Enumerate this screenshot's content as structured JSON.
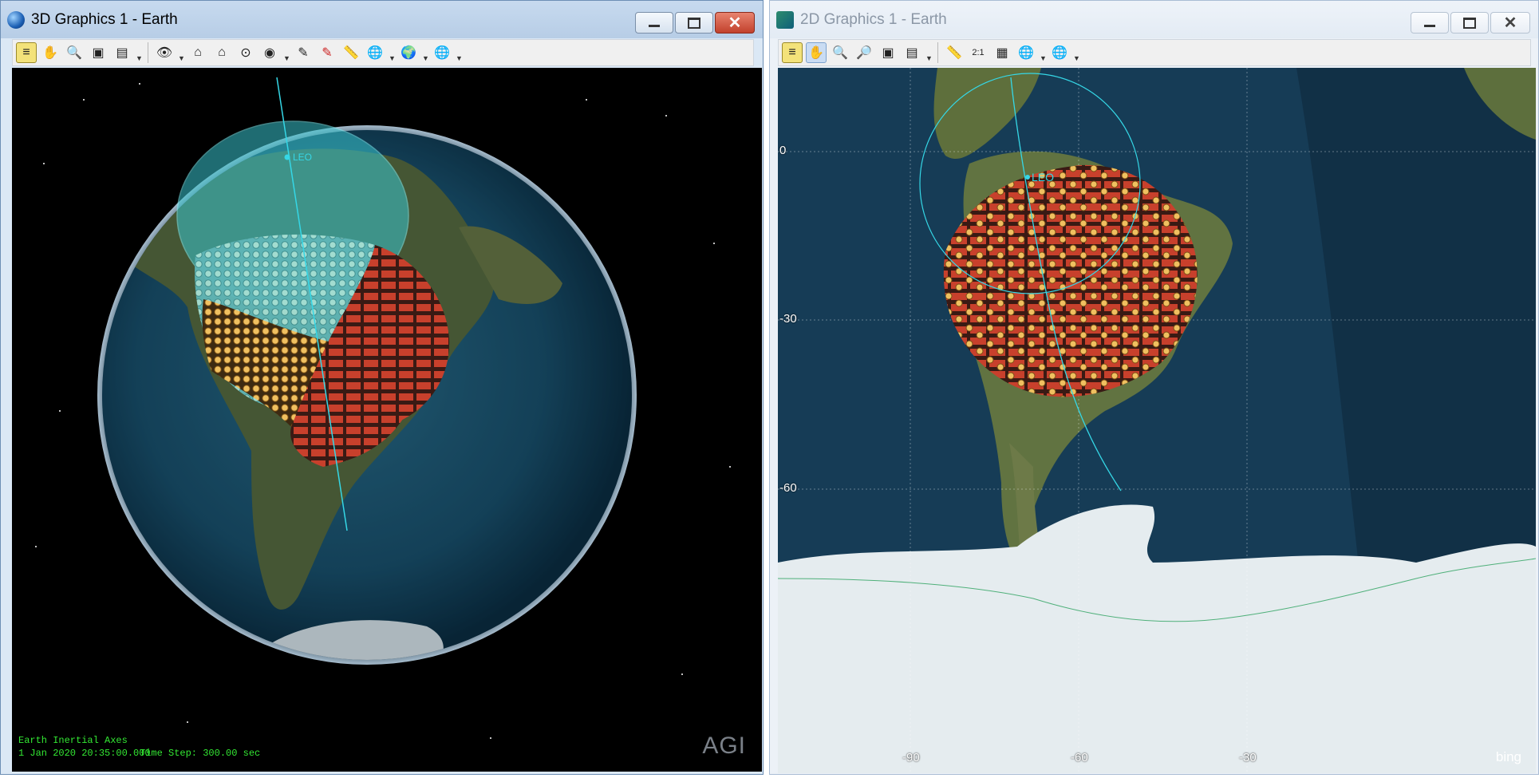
{
  "left_window": {
    "title": "3D Graphics 1 - Earth",
    "hud_axes": "Earth Inertial Axes",
    "hud_time": "1 Jan 2020 20:35:00.000",
    "hud_step": "Time Step: 300.00 sec",
    "logo": "AGI",
    "satellite_label": "LEO"
  },
  "right_window": {
    "title": "2D Graphics 1 - Earth",
    "satellite_label": "LEO",
    "lat_labels": [
      "0",
      "-30",
      "-60"
    ],
    "lon_labels": [
      "-90",
      "-60",
      "-30"
    ],
    "provider": "bing"
  },
  "colors": {
    "accent": "#35d7e6",
    "ocean": "#1b4f6b",
    "land": "#5f6f3c",
    "facility_fill": "#f0c060",
    "label_red": "#c8402c",
    "hud_text": "#33e833"
  }
}
